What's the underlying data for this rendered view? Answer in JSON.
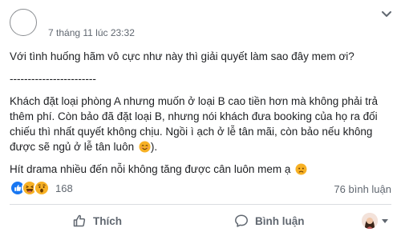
{
  "post": {
    "timestamp": "7 tháng 11 lúc 23:32",
    "paragraphs": [
      "Với tình huống hãm vô cực như này thì giải quyết làm sao đây mem ơi?",
      "------------------------",
      "Khách đặt loại phòng A nhưng muốn ở loại B cao tiền hơn mà không phải trả thêm phí. Còn bảo đã đặt loại B, nhưng nói khách đưa booking của họ ra đối chiếu thì nhất quyết không chịu. Ngồi ì ạch ở lễ tân mãi, còn bảo nếu không được sẽ ngủ ở lễ tân luôn",
      "Hít drama nhiều đến nỗi không tăng được cân luôn mem ạ"
    ],
    "para3_suffix": ").",
    "emoji_1": "smiling-blush-emoji",
    "emoji_2": "sad-face-emoji"
  },
  "reactions": {
    "count": "168",
    "icons": [
      "like-reaction-icon",
      "haha-reaction-icon",
      "wow-reaction-icon"
    ]
  },
  "comments": {
    "label": "76 bình luận"
  },
  "actions": {
    "like_label": "Thích",
    "comment_label": "Bình luận"
  },
  "colors": {
    "like_blue": "#1877f2",
    "reaction_yellow": "#f7b125",
    "muted_text": "#606770"
  }
}
